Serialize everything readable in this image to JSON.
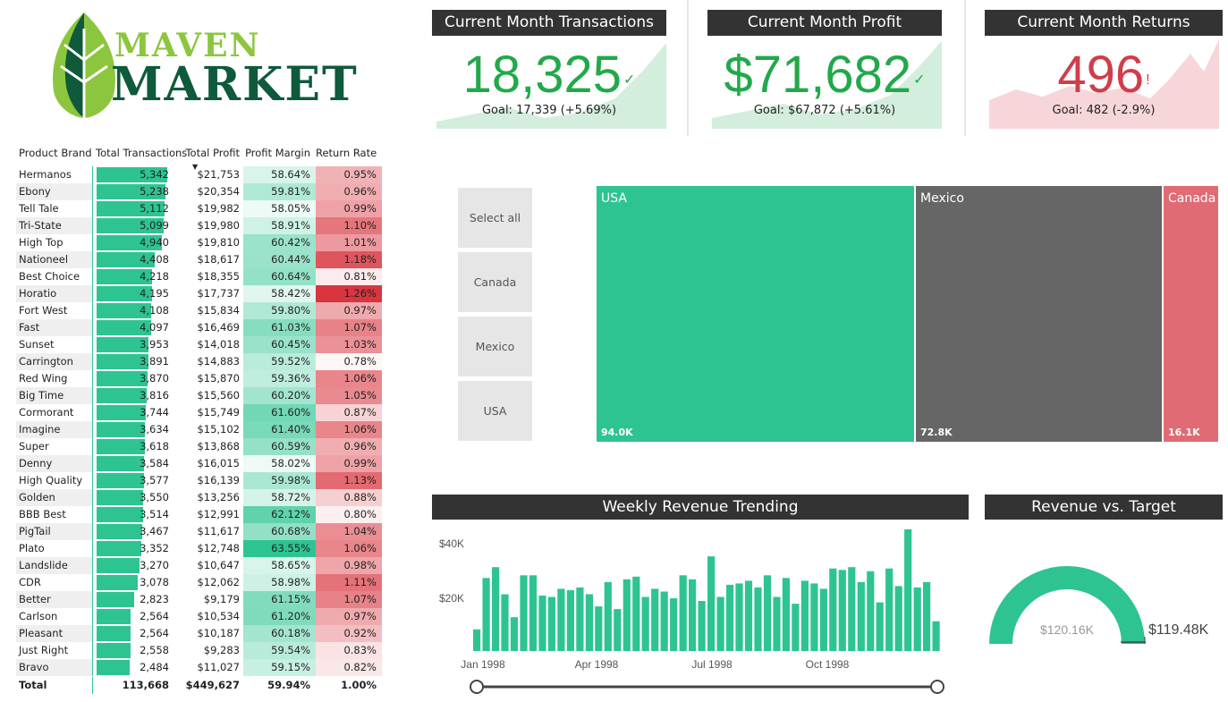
{
  "logo": {
    "line1": "MAVEN",
    "line2": "MARKET"
  },
  "table": {
    "headers": [
      "Product Brand",
      "Total Transactions",
      "Total Profit",
      "Profit Margin",
      "Return Rate"
    ],
    "rows": [
      {
        "brand": "Hermanos",
        "tx": "5,342",
        "profit": "$21,753",
        "margin": "58.64%",
        "ret": "0.95%"
      },
      {
        "brand": "Ebony",
        "tx": "5,238",
        "profit": "$20,354",
        "margin": "59.81%",
        "ret": "0.96%"
      },
      {
        "brand": "Tell Tale",
        "tx": "5,112",
        "profit": "$19,982",
        "margin": "58.05%",
        "ret": "0.99%"
      },
      {
        "brand": "Tri-State",
        "tx": "5,099",
        "profit": "$19,980",
        "margin": "58.91%",
        "ret": "1.10%"
      },
      {
        "brand": "High Top",
        "tx": "4,940",
        "profit": "$19,810",
        "margin": "60.42%",
        "ret": "1.01%"
      },
      {
        "brand": "Nationeel",
        "tx": "4,408",
        "profit": "$18,617",
        "margin": "60.44%",
        "ret": "1.18%"
      },
      {
        "brand": "Best Choice",
        "tx": "4,218",
        "profit": "$18,355",
        "margin": "60.64%",
        "ret": "0.81%"
      },
      {
        "brand": "Horatio",
        "tx": "4,195",
        "profit": "$17,737",
        "margin": "58.42%",
        "ret": "1.26%"
      },
      {
        "brand": "Fort West",
        "tx": "4,108",
        "profit": "$15,834",
        "margin": "59.80%",
        "ret": "0.97%"
      },
      {
        "brand": "Fast",
        "tx": "4,097",
        "profit": "$16,469",
        "margin": "61.03%",
        "ret": "1.07%"
      },
      {
        "brand": "Sunset",
        "tx": "3,953",
        "profit": "$14,018",
        "margin": "60.45%",
        "ret": "1.03%"
      },
      {
        "brand": "Carrington",
        "tx": "3,891",
        "profit": "$14,883",
        "margin": "59.52%",
        "ret": "0.78%"
      },
      {
        "brand": "Red Wing",
        "tx": "3,870",
        "profit": "$15,870",
        "margin": "59.36%",
        "ret": "1.06%"
      },
      {
        "brand": "Big Time",
        "tx": "3,816",
        "profit": "$15,560",
        "margin": "60.20%",
        "ret": "1.05%"
      },
      {
        "brand": "Cormorant",
        "tx": "3,744",
        "profit": "$15,749",
        "margin": "61.60%",
        "ret": "0.87%"
      },
      {
        "brand": "Imagine",
        "tx": "3,634",
        "profit": "$15,102",
        "margin": "61.40%",
        "ret": "1.06%"
      },
      {
        "brand": "Super",
        "tx": "3,618",
        "profit": "$13,868",
        "margin": "60.59%",
        "ret": "0.96%"
      },
      {
        "brand": "Denny",
        "tx": "3,584",
        "profit": "$16,015",
        "margin": "58.02%",
        "ret": "0.99%"
      },
      {
        "brand": "High Quality",
        "tx": "3,577",
        "profit": "$16,139",
        "margin": "59.98%",
        "ret": "1.13%"
      },
      {
        "brand": "Golden",
        "tx": "3,550",
        "profit": "$13,256",
        "margin": "58.72%",
        "ret": "0.88%"
      },
      {
        "brand": "BBB Best",
        "tx": "3,514",
        "profit": "$12,991",
        "margin": "62.12%",
        "ret": "0.80%"
      },
      {
        "brand": "PigTail",
        "tx": "3,467",
        "profit": "$11,617",
        "margin": "60.68%",
        "ret": "1.04%"
      },
      {
        "brand": "Plato",
        "tx": "3,352",
        "profit": "$12,748",
        "margin": "63.55%",
        "ret": "1.06%"
      },
      {
        "brand": "Landslide",
        "tx": "3,270",
        "profit": "$10,647",
        "margin": "58.65%",
        "ret": "0.98%"
      },
      {
        "brand": "CDR",
        "tx": "3,078",
        "profit": "$12,062",
        "margin": "58.98%",
        "ret": "1.11%"
      },
      {
        "brand": "Better",
        "tx": "2,823",
        "profit": "$9,179",
        "margin": "61.15%",
        "ret": "1.07%"
      },
      {
        "brand": "Carlson",
        "tx": "2,564",
        "profit": "$10,534",
        "margin": "61.20%",
        "ret": "0.97%"
      },
      {
        "brand": "Pleasant",
        "tx": "2,564",
        "profit": "$10,187",
        "margin": "60.18%",
        "ret": "0.92%"
      },
      {
        "brand": "Just Right",
        "tx": "2,558",
        "profit": "$9,283",
        "margin": "59.54%",
        "ret": "0.83%"
      },
      {
        "brand": "Bravo",
        "tx": "2,484",
        "profit": "$11,027",
        "margin": "59.15%",
        "ret": "0.82%"
      }
    ],
    "total": {
      "label": "Total",
      "tx": "113,668",
      "profit": "$449,627",
      "margin": "59.94%",
      "ret": "1.00%"
    },
    "colors": {
      "bar": "#2ec492",
      "margin_high": "#2ec492",
      "return_high": "#d9353f"
    }
  },
  "kpis": [
    {
      "title": "Current Month Transactions",
      "value": "18,325",
      "mark": "✓",
      "goal": "Goal: 17,339 (+5.69%)",
      "status": "good"
    },
    {
      "title": "Current Month Profit",
      "value": "$71,682",
      "mark": "✓",
      "goal": "Goal: $67,872 (+5.61%)",
      "status": "good"
    },
    {
      "title": "Current Month Returns",
      "value": "496",
      "mark": "!",
      "goal": "Goal: 482 (-2.9%)",
      "status": "bad"
    }
  ],
  "kpi_colors": {
    "good": "#21a94a",
    "good_area": "#d3eedc",
    "bad": "#d13d4a",
    "bad_area": "#f7d6da"
  },
  "slicer": {
    "items": [
      "Select all",
      "Canada",
      "Mexico",
      "USA"
    ]
  },
  "treemap": {
    "items": [
      {
        "name": "USA",
        "value": "94.0K",
        "num": 94.0,
        "color": "#2ec492"
      },
      {
        "name": "Mexico",
        "value": "72.8K",
        "num": 72.8,
        "color": "#666666"
      },
      {
        "name": "Canada",
        "value": "16.1K",
        "num": 16.1,
        "color": "#e06b74"
      }
    ]
  },
  "weekly": {
    "title": "Weekly Revenue Trending",
    "y_ticks": [
      "$40K",
      "$20K"
    ],
    "x_ticks": [
      "Jan 1998",
      "Apr 1998",
      "Jul 1998",
      "Oct 1998"
    ],
    "bar_color": "#2ec492",
    "chart_data": {
      "type": "bar",
      "ylim": [
        0,
        45000
      ],
      "values": [
        8000,
        27000,
        31000,
        21000,
        12500,
        28000,
        28000,
        20500,
        20000,
        23000,
        22500,
        23500,
        21000,
        16500,
        25500,
        15500,
        26500,
        27500,
        20000,
        23000,
        22000,
        19500,
        28000,
        26500,
        18500,
        35000,
        20000,
        24500,
        25000,
        26000,
        23500,
        28000,
        20000,
        27000,
        17500,
        26000,
        25000,
        23000,
        30500,
        30000,
        31000,
        25500,
        29500,
        18000,
        30500,
        24000,
        45000,
        23500,
        25500,
        11000
      ]
    }
  },
  "gauge": {
    "title": "Revenue vs. Target",
    "inner_label": "$120.16K",
    "target_label": "$119.48K",
    "color": "#2ec492",
    "value": 120.16,
    "target": 119.48
  }
}
